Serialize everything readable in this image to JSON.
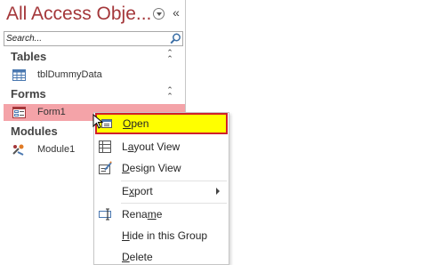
{
  "nav": {
    "title": "All Access Obje...",
    "search_placeholder": "Search...",
    "groups": [
      {
        "label": "Tables",
        "items": [
          {
            "label": "tblDummyData",
            "icon": "table-icon"
          }
        ]
      },
      {
        "label": "Forms",
        "items": [
          {
            "label": "Form1",
            "icon": "form-icon",
            "selected": true
          }
        ]
      },
      {
        "label": "Modules",
        "items": [
          {
            "label": "Module1",
            "icon": "module-icon"
          }
        ]
      }
    ]
  },
  "context_menu": {
    "items": [
      {
        "label": "Open",
        "mnemonic_index": 0,
        "icon": "open-form-icon",
        "highlighted": true
      },
      {
        "label": "Layout View",
        "mnemonic_index": 1,
        "icon": "layout-view-icon"
      },
      {
        "label": "Design View",
        "mnemonic_index": 0,
        "icon": "design-view-icon"
      },
      {
        "label": "Export",
        "mnemonic_index": 1,
        "has_submenu": true
      },
      {
        "label": "Rename",
        "mnemonic_index": 1,
        "icon": "rename-icon"
      },
      {
        "label": "Hide in this Group",
        "mnemonic_index": 0
      },
      {
        "label": "Delete",
        "mnemonic_index": 0
      }
    ]
  },
  "colors": {
    "title": "#a4373a",
    "selection": "#f4a3a8",
    "highlight_fill": "#ffff00",
    "highlight_border": "#d0202a"
  }
}
